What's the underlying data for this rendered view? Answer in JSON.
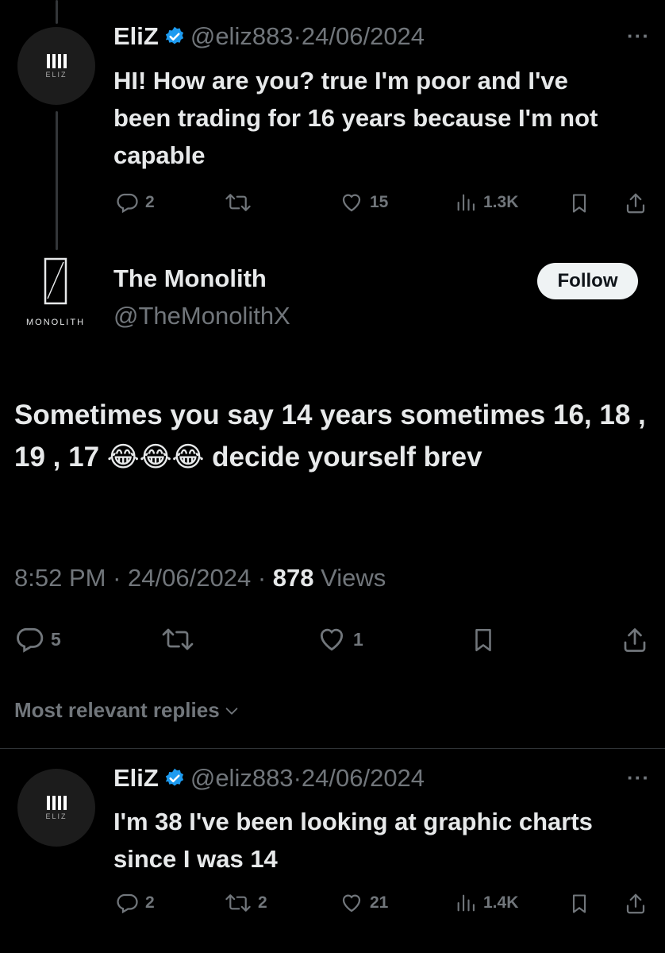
{
  "tweet1": {
    "name": "EliZ",
    "handle": "@eliz883",
    "date": "24/06/2024",
    "text": "HI! How are you? true I'm poor and I've been trading for 16 years because I'm not capable",
    "avatar_sub": "ELIZ",
    "replies": "2",
    "likes": "15",
    "views": "1.3K"
  },
  "main_tweet": {
    "name": "The Monolith",
    "handle": "@TheMonolithX",
    "avatar_sub": "MONOLITH",
    "follow_label": "Follow",
    "text": "Sometimes you say 14 years sometimes 16, 18 , 19 , 17 😂😂😂 decide yourself brev",
    "time": "8:52 PM",
    "date": "24/06/2024",
    "views_count": "878",
    "views_label": "Views",
    "replies": "5",
    "likes": "1"
  },
  "replies_sort": {
    "label": "Most relevant replies"
  },
  "tweet2": {
    "name": "EliZ",
    "handle": "@eliz883",
    "date": "24/06/2024",
    "text": "I'm 38 I've been looking at graphic charts since I was 14",
    "avatar_sub": "ELIZ",
    "replies": "2",
    "retweets": "2",
    "likes": "21",
    "views": "1.4K"
  },
  "colors": {
    "background": "#000000",
    "text": "#e7e9ea",
    "muted": "#71767b",
    "verified": "#1d9bf0"
  }
}
